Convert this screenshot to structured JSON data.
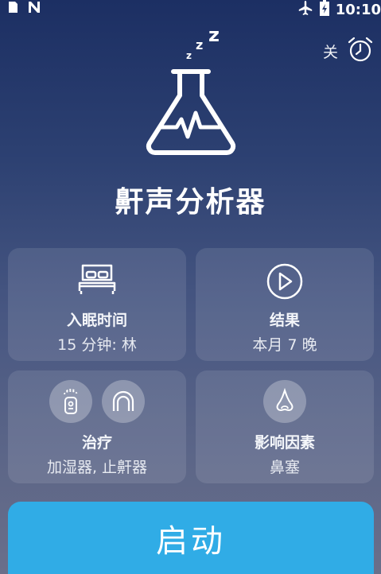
{
  "status_bar": {
    "time": "10:10"
  },
  "alarm": {
    "label": "关"
  },
  "app": {
    "title": "鼾声分析器"
  },
  "cards": {
    "sleep_time": {
      "title": "入眠时间",
      "subtitle": "15 分钟: 林"
    },
    "results": {
      "title": "结果",
      "subtitle": "本月 7 晚"
    },
    "remedies": {
      "title": "治疗",
      "subtitle": "加湿器, 止鼾器"
    },
    "factors": {
      "title": "影响因素",
      "subtitle": "鼻塞"
    }
  },
  "start_button": {
    "label": "启动"
  }
}
